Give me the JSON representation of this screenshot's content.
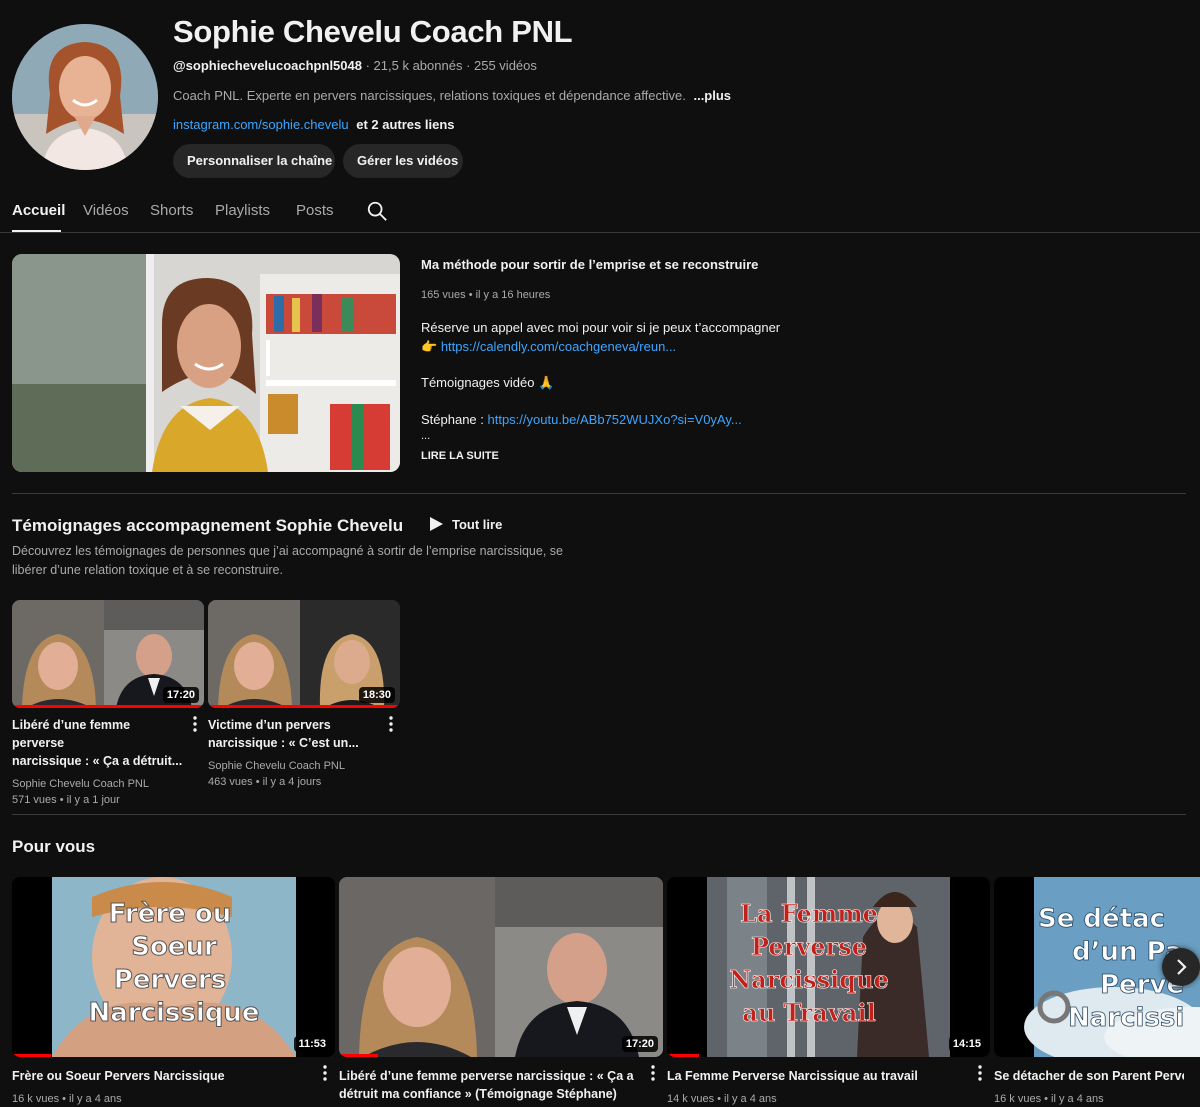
{
  "channel": {
    "name": "Sophie Chevelu Coach PNL",
    "handle": "@sophiechevelucoachpnl5048",
    "meta": "· 21,5 k abonnés · 255 vidéos",
    "description": "Coach PNL. Experte en pervers narcissiques, relations toxiques et dépendance affective.",
    "more": "...plus",
    "link": "instagram.com/sophie.chevelu",
    "other_links": "et 2 autres liens",
    "customize_label": "Personnaliser la chaîne",
    "manage_label": "Gérer les vidéos"
  },
  "tabs": [
    "Accueil",
    "Vidéos",
    "Shorts",
    "Playlists",
    "Posts"
  ],
  "featured": {
    "title": "Ma méthode pour sortir de l’emprise et se reconstruire",
    "meta": "165 vues • il y a 16 heures",
    "line1": "Réserve un appel avec moi pour voir si je peux t’accompagner",
    "line2_emoji": "👉",
    "line2_link": "https://calendly.com/coachgeneva/reun...",
    "line3": "Témoignages vidéo 🙏",
    "line4_label": "Stéphane : ",
    "line4_link": "https://youtu.be/ABb752WUJXo?si=V0yAy...",
    "ellipsis": "...",
    "read_more": "LIRE LA SUITE"
  },
  "playlist": {
    "title": "Témoignages accompagnement Sophie Chevelu",
    "play_all": "Tout lire",
    "description": "Découvrez les témoignages de personnes que j’ai accompagné à sortir de l’emprise narcissique, se libérer d’une relation toxique et à se reconstruire.",
    "videos": [
      {
        "title_l1": "Libéré d’une femme perverse",
        "title_l2": "narcissique : « Ça a détruit...",
        "channel": "Sophie Chevelu Coach PNL",
        "meta": "571 vues • il y a 1 jour",
        "duration": "17:20",
        "progress": 1.0
      },
      {
        "title_l1": "Victime d’un pervers",
        "title_l2": "narcissique : « C’est un...",
        "channel": "Sophie Chevelu Coach PNL",
        "meta": "463 vues • il y a 4 jours",
        "duration": "18:30",
        "progress": 1.0
      }
    ]
  },
  "for_you": {
    "title": "Pour vous",
    "videos": [
      {
        "title_l1": "Frère ou Soeur Pervers Narcissique",
        "title_l2": "",
        "meta": "16 k vues • il y a 4 ans",
        "duration": "11:53",
        "thumb_text": [
          "Frère ou",
          "Soeur",
          "Pervers",
          "Narcissique"
        ],
        "progress": 0.12
      },
      {
        "title_l1": "Libéré d’une femme perverse narcissique : « Ça a",
        "title_l2": "détruit ma confiance » (Témoignage Stéphane)",
        "meta": "",
        "duration": "17:20",
        "thumb_text": [],
        "progress": 0.12
      },
      {
        "title_l1": "La Femme Perverse Narcissique au travail",
        "title_l2": "",
        "meta": "14 k vues • il y a 4 ans",
        "duration": "14:15",
        "thumb_text": [
          "La Femme",
          "Perverse",
          "Narcissique",
          "au Travail"
        ],
        "progress": 0.1
      },
      {
        "title_l1": "Se détacher de son Parent Perver",
        "title_l2": "",
        "meta": "16 k vues • il y a 4 ans",
        "duration": "",
        "thumb_text": [
          "Se détac",
          "d’un Pa",
          "Perve",
          "Narcissi"
        ],
        "progress": 0
      }
    ]
  },
  "colors": {
    "accent_link": "#3ea6ff",
    "progress": "#ff0000",
    "background": "#0f0f0f"
  }
}
